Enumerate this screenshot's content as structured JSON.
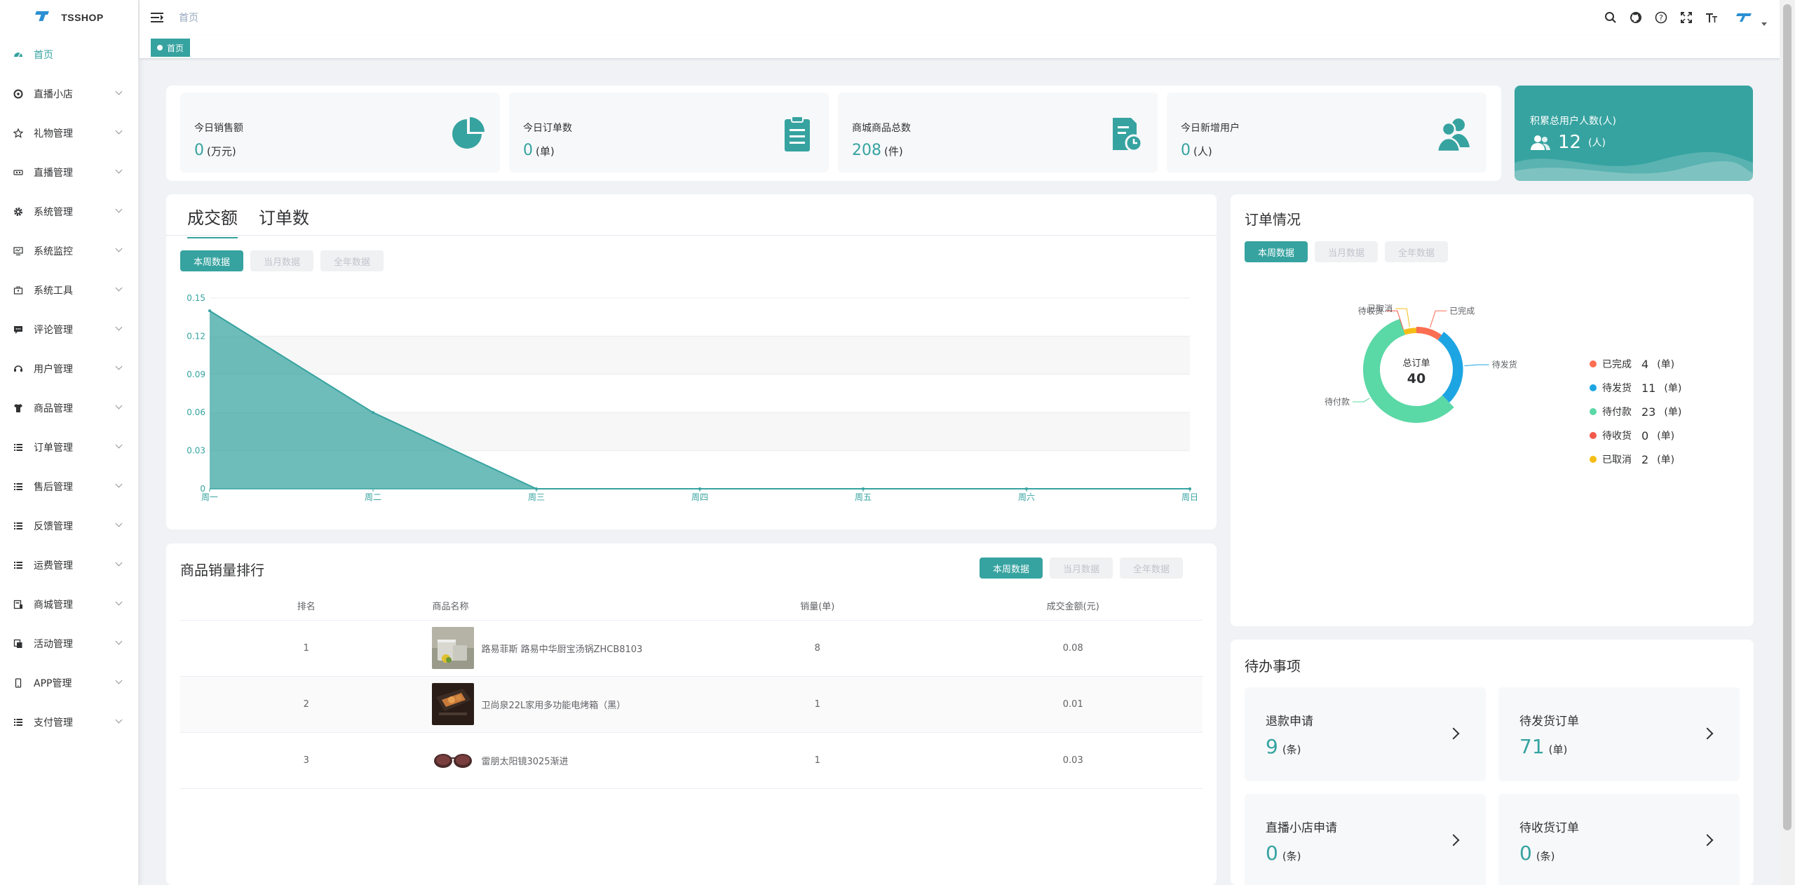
{
  "app": {
    "logo_text": "TSSHOP",
    "accent": "#36a3a0"
  },
  "sidebar": {
    "items": [
      {
        "label": "首页",
        "icon": "dashboard-icon",
        "active": true,
        "has_children": false
      },
      {
        "label": "直播小店",
        "icon": "live-shop-icon",
        "active": false,
        "has_children": true
      },
      {
        "label": "礼物管理",
        "icon": "star-icon",
        "active": false,
        "has_children": true
      },
      {
        "label": "直播管理",
        "icon": "live-icon",
        "active": false,
        "has_children": true
      },
      {
        "label": "系统管理",
        "icon": "gear-icon",
        "active": false,
        "has_children": true
      },
      {
        "label": "系统监控",
        "icon": "monitor-icon",
        "active": false,
        "has_children": true
      },
      {
        "label": "系统工具",
        "icon": "toolbox-icon",
        "active": false,
        "has_children": true
      },
      {
        "label": "评论管理",
        "icon": "comment-icon",
        "active": false,
        "has_children": true
      },
      {
        "label": "用户管理",
        "icon": "user-icon",
        "active": false,
        "has_children": true
      },
      {
        "label": "商品管理",
        "icon": "shirt-icon",
        "active": false,
        "has_children": true
      },
      {
        "label": "订单管理",
        "icon": "list-icon",
        "active": false,
        "has_children": true
      },
      {
        "label": "售后管理",
        "icon": "list-icon",
        "active": false,
        "has_children": true
      },
      {
        "label": "反馈管理",
        "icon": "list-icon",
        "active": false,
        "has_children": true
      },
      {
        "label": "运费管理",
        "icon": "list-icon",
        "active": false,
        "has_children": true
      },
      {
        "label": "商城管理",
        "icon": "store-icon",
        "active": false,
        "has_children": true
      },
      {
        "label": "活动管理",
        "icon": "copy-icon",
        "active": false,
        "has_children": true
      },
      {
        "label": "APP管理",
        "icon": "phone-icon",
        "active": false,
        "has_children": true
      },
      {
        "label": "支付管理",
        "icon": "list-icon",
        "active": false,
        "has_children": true
      }
    ]
  },
  "header": {
    "breadcrumb": "首页",
    "tag": "首页",
    "icons": [
      "search-icon",
      "github-icon",
      "question-icon",
      "fullscreen-icon",
      "font-size-icon"
    ]
  },
  "stats": [
    {
      "label": "今日销售额",
      "value": "0",
      "unit": "(万元)",
      "icon": "pie-chart-icon"
    },
    {
      "label": "今日订单数",
      "value": "0",
      "unit": "(单)",
      "icon": "clipboard-icon"
    },
    {
      "label": "商城商品总数",
      "value": "208",
      "unit": "(件)",
      "icon": "document-clock-icon"
    },
    {
      "label": "今日新增用户",
      "value": "0",
      "unit": "(人)",
      "icon": "users-icon"
    }
  ],
  "total_users": {
    "label": "积累总用户人数(人)",
    "value": "12",
    "unit": "(人)"
  },
  "sales": {
    "tabs": [
      "成交额",
      "订单数"
    ],
    "filters": [
      "本周数据",
      "当月数据",
      "全年数据"
    ]
  },
  "chart_data": {
    "type": "area",
    "categories": [
      "周一",
      "周二",
      "周三",
      "周四",
      "周五",
      "周六",
      "周日"
    ],
    "values": [
      0.14,
      0.06,
      0,
      0,
      0,
      0,
      0
    ],
    "yticks": [
      "0",
      "0.03",
      "0.06",
      "0.09",
      "0.12",
      "0.15"
    ],
    "ylim": [
      0,
      0.15
    ],
    "color": "#36a3a0"
  },
  "ranking": {
    "title": "商品销量排行",
    "filters": [
      "本周数据",
      "当月数据",
      "全年数据"
    ],
    "columns": [
      "排名",
      "商品名称",
      "销量(单)",
      "成交金额(元)"
    ],
    "rows": [
      {
        "rank": "1",
        "name": "路易菲斯 路易中华厨宝汤锅ZHCB8103",
        "sales": "8",
        "amount": "0.08",
        "image": "pot-image"
      },
      {
        "rank": "2",
        "name": "卫尚泉22L家用多功能电烤箱（黑）",
        "sales": "1",
        "amount": "0.01",
        "image": "oven-image"
      },
      {
        "rank": "3",
        "name": "雷朋太阳镜3025渐进",
        "sales": "1",
        "amount": "0.03",
        "image": "sunglasses-image"
      }
    ]
  },
  "orders": {
    "title": "订单情况",
    "filters": [
      "本周数据",
      "当月数据",
      "全年数据"
    ],
    "center_label": "总订单",
    "center_value": "40",
    "slices": [
      {
        "label": "已完成",
        "value": "4",
        "unit": "(单)",
        "color": "#fb6e52"
      },
      {
        "label": "待发货",
        "value": "11",
        "unit": "(单)",
        "color": "#1da5e3"
      },
      {
        "label": "待付款",
        "value": "23",
        "unit": "(单)",
        "color": "#5ad8a6"
      },
      {
        "label": "待收货",
        "value": "0",
        "unit": "(单)",
        "color": "#f2594b"
      },
      {
        "label": "已取消",
        "value": "2",
        "unit": "(单)",
        "color": "#f6bd16"
      }
    ]
  },
  "todo": {
    "title": "待办事项",
    "items": [
      {
        "label": "退款申请",
        "value": "9",
        "unit": "(条)"
      },
      {
        "label": "待发货订单",
        "value": "71",
        "unit": "(单)"
      },
      {
        "label": "直播小店申请",
        "value": "0",
        "unit": "(条)"
      },
      {
        "label": "待收货订单",
        "value": "0",
        "unit": "(条)"
      }
    ]
  }
}
